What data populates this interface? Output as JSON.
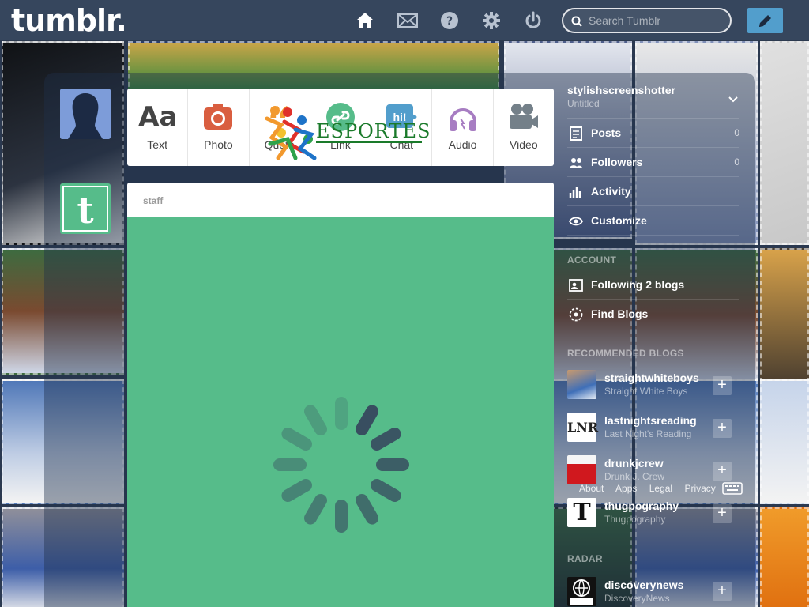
{
  "topbar": {
    "logo": "tumblr.",
    "nav_icons": [
      "home-icon",
      "mail-icon",
      "help-icon",
      "settings-icon",
      "power-icon"
    ],
    "search_placeholder": "Search Tumblr",
    "compose_icon": "pencil-icon"
  },
  "post_types": [
    {
      "label": "Text",
      "icon": "text-icon",
      "color": "#444444"
    },
    {
      "label": "Photo",
      "icon": "camera-icon",
      "color": "#d95e40"
    },
    {
      "label": "Quote",
      "icon": "quote-icon",
      "color": "#f2992e"
    },
    {
      "label": "Link",
      "icon": "link-icon",
      "color": "#56bc8a"
    },
    {
      "label": "Chat",
      "icon": "chat-icon",
      "color": "#529ecc"
    },
    {
      "label": "Audio",
      "icon": "headphones-icon",
      "color": "#a77dc2"
    },
    {
      "label": "Video",
      "icon": "video-camera-icon",
      "color": "#748089"
    }
  ],
  "overlay_logo_text": "ESPORTES",
  "post": {
    "author": "staff",
    "body_color": "#56bc8a",
    "state": "loading"
  },
  "sidebar": {
    "blog_name": "stylishscreenshotter",
    "blog_title": "Untitled",
    "items": [
      {
        "label": "Posts",
        "count": "0",
        "icon": "posts-icon"
      },
      {
        "label": "Followers",
        "count": "0",
        "icon": "followers-icon"
      },
      {
        "label": "Activity",
        "count": "",
        "icon": "activity-icon"
      },
      {
        "label": "Customize",
        "count": "",
        "icon": "eye-icon"
      }
    ],
    "account_header": "ACCOUNT",
    "account_items": [
      {
        "label": "Following 2 blogs",
        "icon": "following-icon"
      },
      {
        "label": "Find Blogs",
        "icon": "compass-icon"
      }
    ],
    "recommended_header": "RECOMMENDED BLOGS",
    "recommended": [
      {
        "name": "straightwhiteboys",
        "subtitle": "Straight White Boys"
      },
      {
        "name": "lastnightsreading",
        "subtitle": "Last Night's Reading"
      },
      {
        "name": "drunkjcrew",
        "subtitle": "Drunk J. Crew"
      },
      {
        "name": "thugpography",
        "subtitle": "Thugpography"
      }
    ],
    "radar_header": "RADAR",
    "radar": {
      "name": "discoverynews",
      "subtitle": "DiscoveryNews"
    },
    "footer_links": [
      "About",
      "Apps",
      "Legal",
      "Privacy"
    ]
  },
  "colors": {
    "topbar": "#36465d",
    "accent": "#529ecc",
    "staff_green": "#56bc8a"
  }
}
